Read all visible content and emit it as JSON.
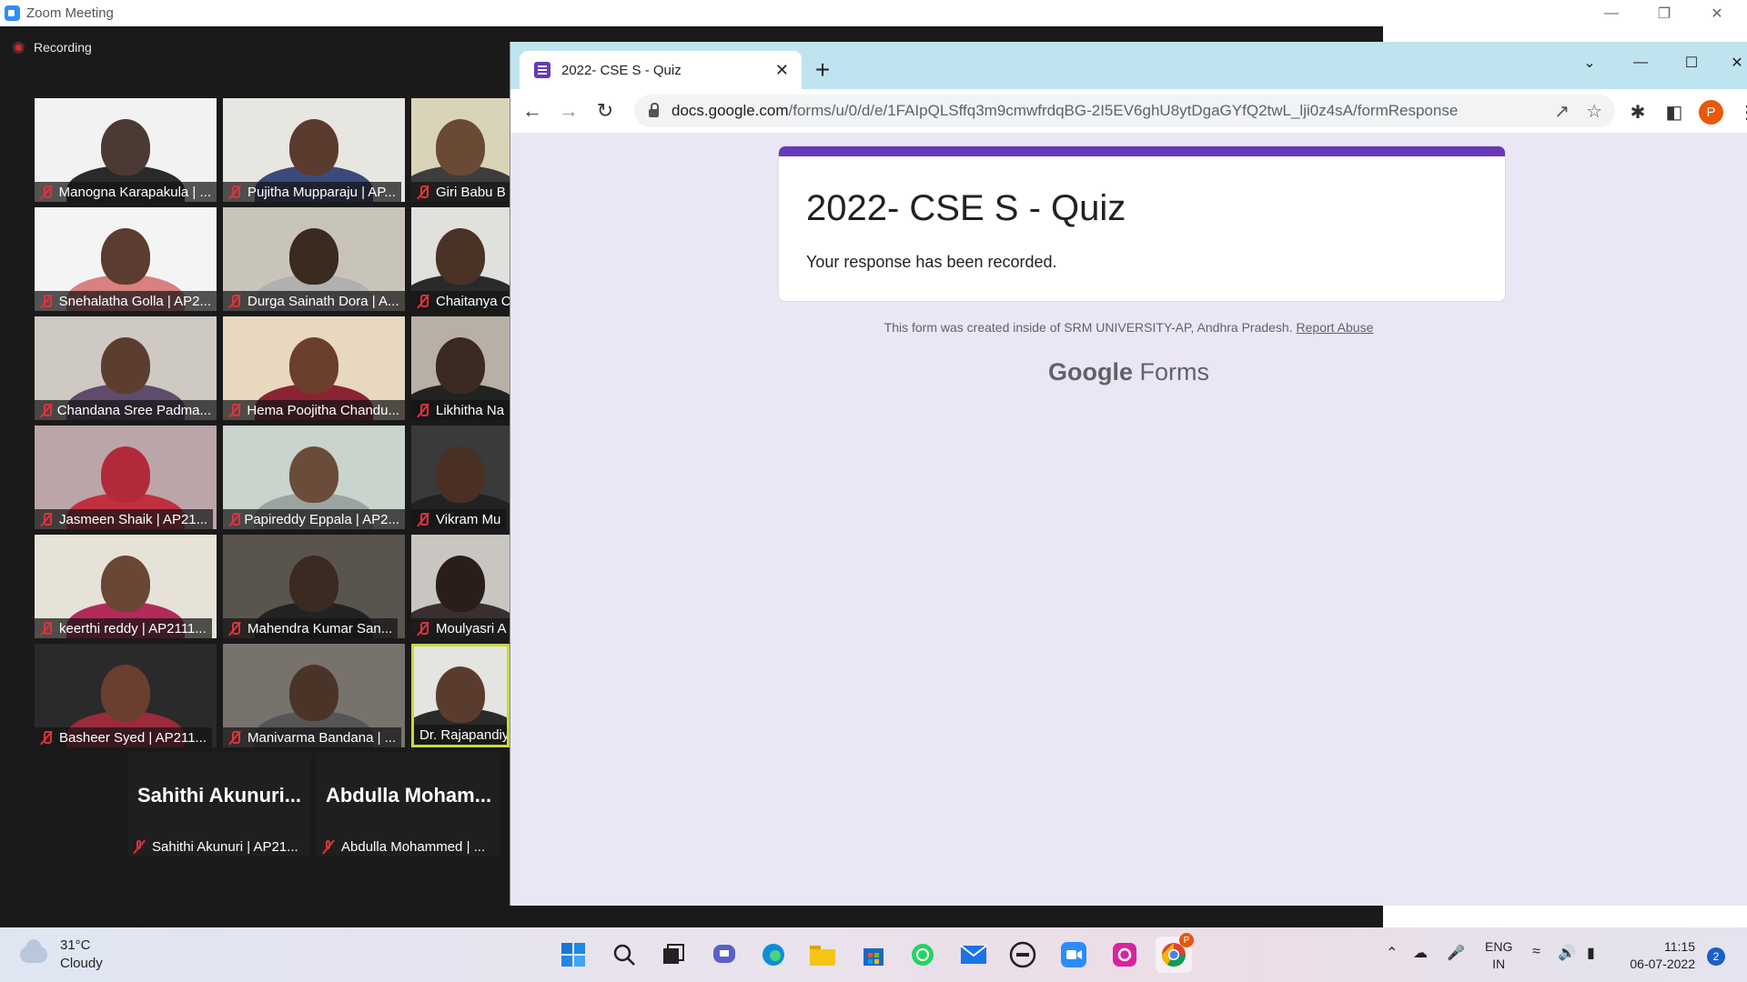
{
  "zoom": {
    "window_title": "Zoom Meeting",
    "recording_label": "Recording",
    "tiles": [
      {
        "name": "Manogna Karapakula | ..."
      },
      {
        "name": "Pujitha Mupparaju | AP..."
      },
      {
        "name": "Giri Babu B"
      },
      {
        "name": "Snehalatha Golla | AP2..."
      },
      {
        "name": "Durga Sainath Dora | A..."
      },
      {
        "name": "Chaitanya C"
      },
      {
        "name": "Chandana Sree Padma..."
      },
      {
        "name": "Hema Poojitha Chandu..."
      },
      {
        "name": "Likhitha Na"
      },
      {
        "name": "Jasmeen Shaik | AP21..."
      },
      {
        "name": "Papireddy Eppala | AP2..."
      },
      {
        "name": "Vikram Mu"
      },
      {
        "name": "keerthi reddy | AP2111..."
      },
      {
        "name": "Mahendra Kumar San..."
      },
      {
        "name": "Moulyasri A"
      },
      {
        "name": "Basheer Syed | AP211..."
      },
      {
        "name": "Manivarma Bandana | ..."
      },
      {
        "name": "Dr. Rajapandiy"
      }
    ],
    "name_tiles": [
      {
        "display": "Sahithi  Akunuri...",
        "label": "Sahithi Akunuri | AP21..."
      },
      {
        "display": "Abdulla  Moham...",
        "label": "Abdulla Mohammed | ..."
      }
    ]
  },
  "chrome": {
    "tab_title": "2022- CSE S - Quiz",
    "url_domain": "docs.google.com",
    "url_path": "/forms/u/0/d/e/1FAIpQLSffq3m9cmwfrdqBG-2I5EV6ghU8ytDgaGYfQ2twL_lji0z4sA/formResponse",
    "profile_initial": "P"
  },
  "form": {
    "title": "2022- CSE S - Quiz",
    "response_text": "Your response has been recorded.",
    "footnote": "This form was created inside of SRM UNIVERSITY-AP, Andhra Pradesh.",
    "report_abuse": "Report Abuse",
    "brand_google": "Google",
    "brand_forms": "Forms",
    "accent_color": "#673ab7"
  },
  "taskbar": {
    "temperature": "31°C",
    "condition": "Cloudy",
    "lang_line1": "ENG",
    "lang_line2": "IN",
    "time": "11:15",
    "date": "06-07-2022",
    "notification_count": "2",
    "chrome_badge": "P"
  }
}
